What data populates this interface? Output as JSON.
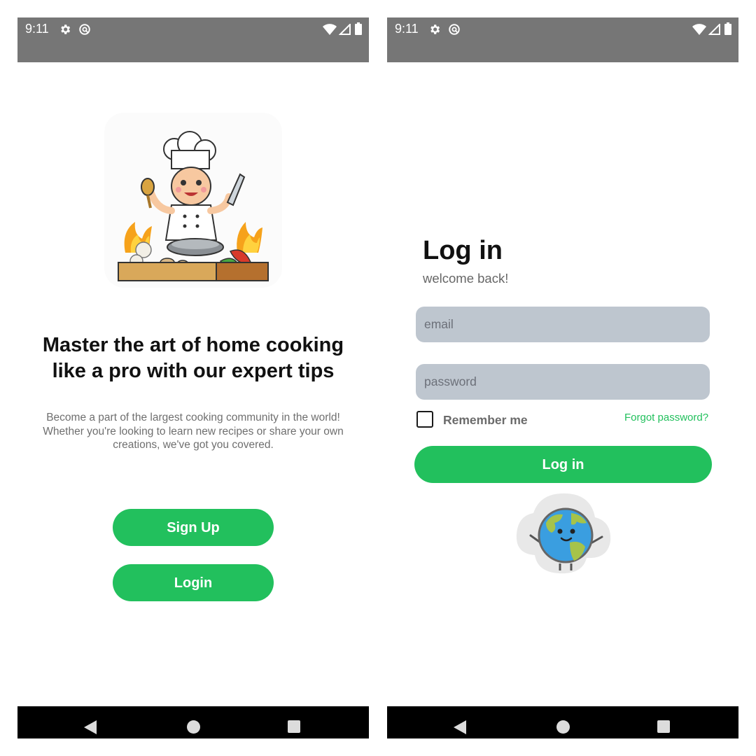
{
  "status_bar": {
    "time": "9:11"
  },
  "welcome_screen": {
    "headline_line1": "Master the art of home cooking",
    "headline_line2": "like a pro with our expert tips",
    "subtext_line1": "Become a part of the largest cooking community in the world!",
    "subtext_line2": "Whether you're looking to learn new recipes or share your own",
    "subtext_line3": "creations, we've got you covered.",
    "signup_label": "Sign Up",
    "login_label": "Login"
  },
  "login_screen": {
    "title": "Log in",
    "subtitle": "welcome back!",
    "email_placeholder": "email",
    "password_placeholder": "password",
    "remember_label": "Remember me",
    "forgot_label": "Forgot password?",
    "submit_label": "Log in"
  },
  "colors": {
    "accent": "#22c05d",
    "status_bar": "#767676",
    "input_bg": "#bec6cf",
    "nav_bar": "#000000"
  },
  "icons": {
    "status": [
      "gear-icon",
      "sync-icon",
      "wifi-icon",
      "signal-icon",
      "battery-icon"
    ],
    "nav": [
      "back-icon",
      "home-icon",
      "recents-icon"
    ]
  }
}
